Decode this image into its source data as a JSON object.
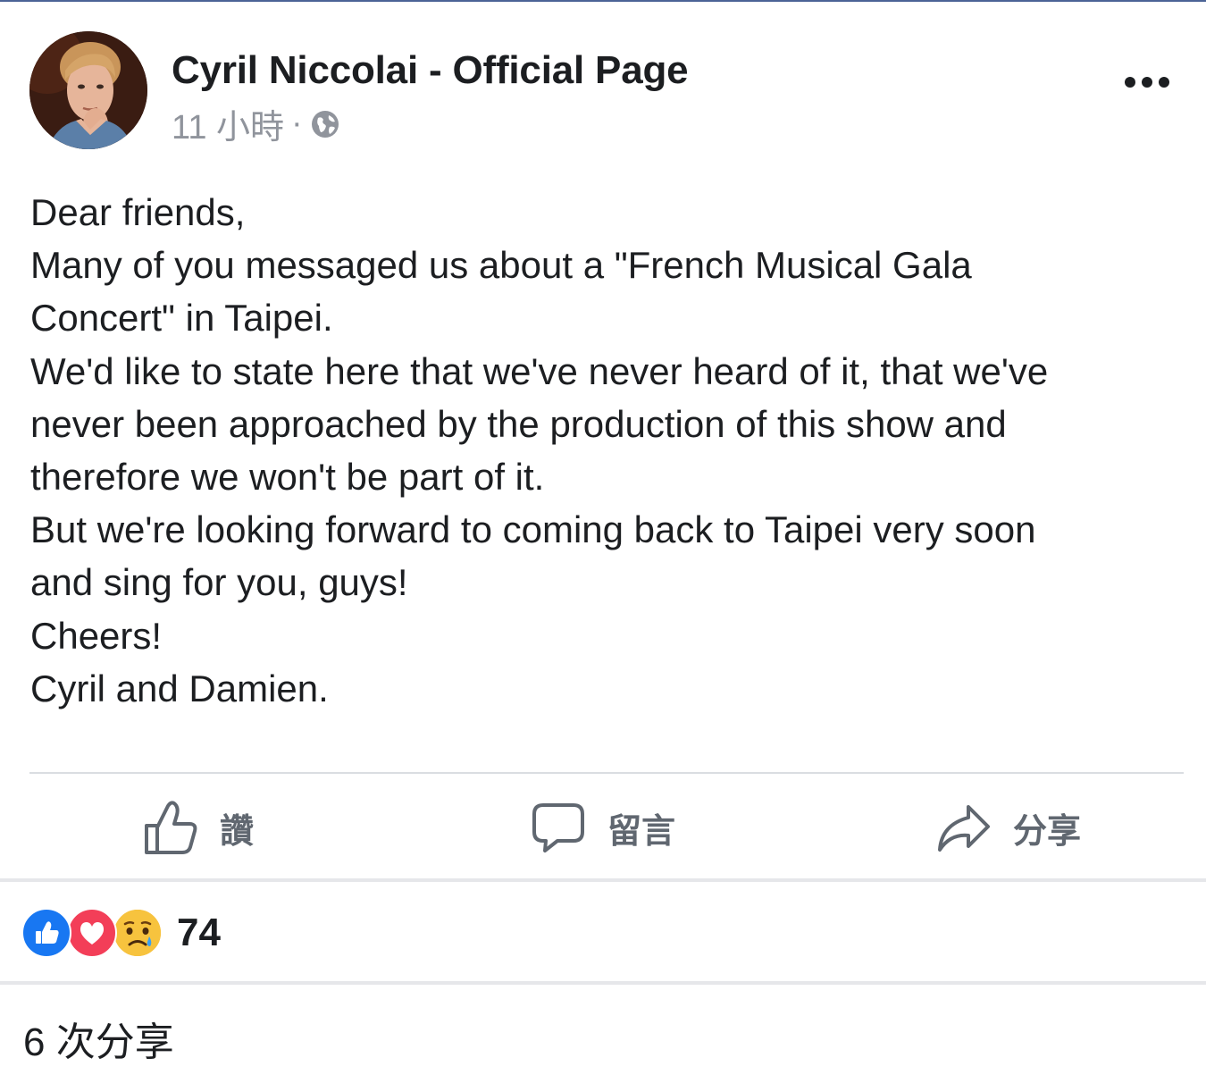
{
  "post": {
    "author": "Cyril Niccolai - Official Page",
    "timestamp": "11 小時",
    "separator": "·",
    "privacy_icon": "globe-icon",
    "more_icon": "ellipsis-icon",
    "body_lines": [
      "Dear friends,",
      "Many of you messaged us about a \"French Musical Gala",
      "Concert\" in Taipei.",
      "We'd like to state here that we've never heard of it, that we've",
      "never been approached by the production of this show and",
      "therefore we won't be part of it.",
      "But we're looking forward to coming back to Taipei very soon",
      "and sing for you, guys!",
      "Cheers!",
      "Cyril and Damien."
    ]
  },
  "actions": {
    "like_label": "讚",
    "comment_label": "留言",
    "share_label": "分享"
  },
  "stats": {
    "reactions": [
      "like",
      "love",
      "sad"
    ],
    "reaction_count": "74",
    "share_count": "6 次分享"
  },
  "colors": {
    "like_blue": "#1877f2",
    "love_red": "#f33e58",
    "sad_yellow": "#f7b125",
    "meta_gray": "#90949c",
    "action_gray": "#606770"
  }
}
